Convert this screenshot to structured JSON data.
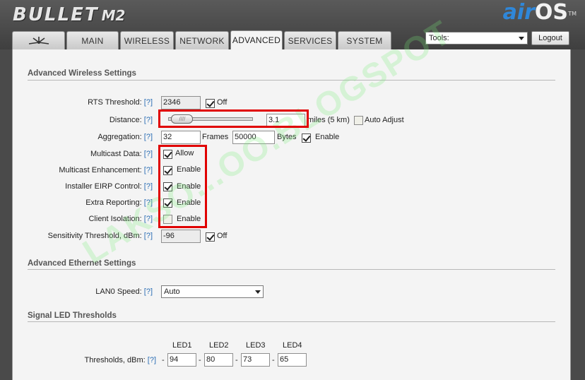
{
  "header": {
    "brand": "BULLET",
    "model": "M2",
    "os_prefix": "air",
    "os_suffix": "OS",
    "trademark": "TM"
  },
  "tabs": [
    {
      "label": "",
      "icon": "ubiquiti-logo-icon"
    },
    {
      "label": "MAIN"
    },
    {
      "label": "WIRELESS"
    },
    {
      "label": "NETWORK"
    },
    {
      "label": "ADVANCED",
      "active": true
    },
    {
      "label": "SERVICES"
    },
    {
      "label": "SYSTEM"
    }
  ],
  "tools": {
    "label": "Tools:"
  },
  "logout_label": "Logout",
  "help_text": "[?]",
  "wireless": {
    "title": "Advanced Wireless Settings",
    "rts": {
      "label": "RTS Threshold:",
      "value": "2346",
      "off_label": "Off",
      "off_checked": true
    },
    "distance": {
      "label": "Distance:",
      "thumb_label": "////",
      "value": "3.1",
      "unit_label": "miles (5 km)",
      "auto_label": "Auto Adjust",
      "auto_checked": false,
      "slider_fraction": 0.05
    },
    "aggregation": {
      "label": "Aggregation:",
      "frames_value": "32",
      "frames_label": "Frames",
      "bytes_value": "50000",
      "bytes_label": "Bytes",
      "enable_label": "Enable",
      "enable_checked": true
    },
    "multicast_data": {
      "label": "Multicast Data:",
      "option_label": "Allow",
      "checked": true
    },
    "multicast_enhancement": {
      "label": "Multicast Enhancement:",
      "option_label": "Enable",
      "checked": true
    },
    "installer_eirp": {
      "label": "Installer EIRP Control:",
      "option_label": "Enable",
      "checked": true
    },
    "extra_reporting": {
      "label": "Extra Reporting:",
      "option_label": "Enable",
      "checked": true
    },
    "client_isolation": {
      "label": "Client Isolation:",
      "option_label": "Enable",
      "checked": false
    },
    "sensitivity": {
      "label": "Sensitivity Threshold, dBm:",
      "value": "-96",
      "off_label": "Off",
      "off_checked": true
    }
  },
  "ethernet": {
    "title": "Advanced Ethernet Settings",
    "lan0_label": "LAN0 Speed:",
    "lan0_value": "Auto"
  },
  "led": {
    "title": "Signal LED Thresholds",
    "headers": [
      "LED1",
      "LED2",
      "LED3",
      "LED4"
    ],
    "label": "Thresholds, dBm:",
    "separator": "-",
    "values": [
      "94",
      "80",
      "73",
      "65"
    ]
  },
  "watermark": "LAKSO...OO.BLOGSPOT",
  "colors": {
    "accent_red": "#e00000",
    "help_link": "#2d6fb5",
    "air_blue": "#2f87d9"
  }
}
